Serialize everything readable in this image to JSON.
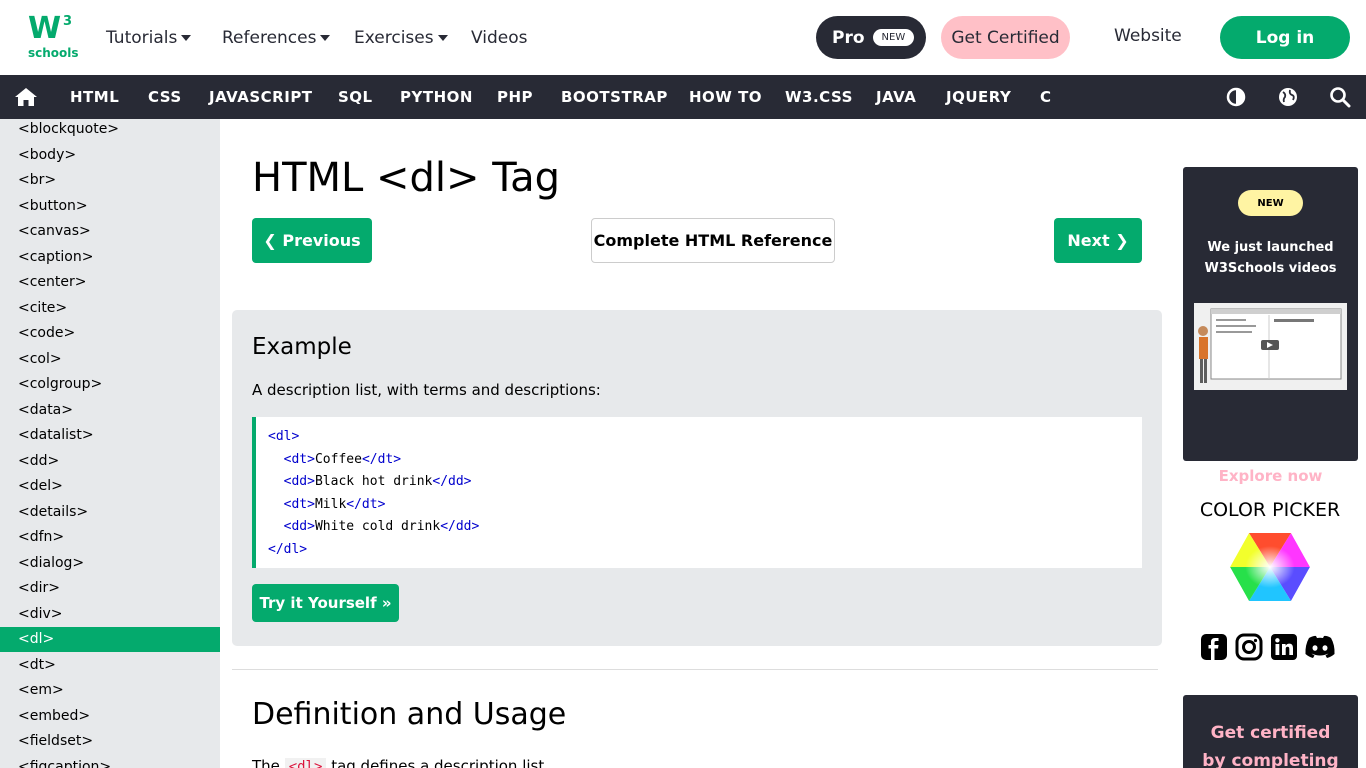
{
  "header": {
    "logo": {
      "main": "W",
      "sup": "3",
      "sub": "schools"
    },
    "menus": [
      {
        "label": "Tutorials"
      },
      {
        "label": "References"
      },
      {
        "label": "Exercises"
      }
    ],
    "videos": "Videos",
    "pro": {
      "label": "Pro",
      "badge": "NEW"
    },
    "get_certified": "Get Certified",
    "website": "Website",
    "login": "Log in"
  },
  "navbar": {
    "items": [
      "HTML",
      "CSS",
      "JAVASCRIPT",
      "SQL",
      "PYTHON",
      "PHP",
      "BOOTSTRAP",
      "HOW TO",
      "W3.CSS",
      "JAVA",
      "JQUERY",
      "C"
    ],
    "icons": [
      "home-icon",
      "contrast-icon",
      "globe-icon",
      "search-icon"
    ]
  },
  "sidebar": {
    "items": [
      "<blockquote>",
      "<body>",
      "<br>",
      "<button>",
      "<canvas>",
      "<caption>",
      "<center>",
      "<cite>",
      "<code>",
      "<col>",
      "<colgroup>",
      "<data>",
      "<datalist>",
      "<dd>",
      "<del>",
      "<details>",
      "<dfn>",
      "<dialog>",
      "<dir>",
      "<div>",
      "<dl>",
      "<dt>",
      "<em>",
      "<embed>",
      "<fieldset>",
      "<figcaption>"
    ],
    "active_index": 20
  },
  "main": {
    "title": "HTML <dl> Tag",
    "prev": "❮ Previous",
    "reference": "Complete HTML Reference",
    "next": "Next ❯",
    "example": {
      "heading": "Example",
      "description": "A description list, with terms and descriptions:",
      "code": [
        {
          "indent": "",
          "open": "<dl>",
          "text": "",
          "close": ""
        },
        {
          "indent": "  ",
          "open": "<dt>",
          "text": "Coffee",
          "close": "</dt>"
        },
        {
          "indent": "  ",
          "open": "<dd>",
          "text": "Black hot drink",
          "close": "</dd>"
        },
        {
          "indent": "  ",
          "open": "<dt>",
          "text": "Milk",
          "close": "</dt>"
        },
        {
          "indent": "  ",
          "open": "<dd>",
          "text": "White cold drink",
          "close": "</dd>"
        },
        {
          "indent": "",
          "open": "</dl>",
          "text": "",
          "close": ""
        }
      ],
      "try_button": "Try it Yourself »"
    },
    "definition": {
      "heading": "Definition and Usage",
      "line_prefix": "The",
      "line_code": "<dl>",
      "line_suffix": "tag defines a description list."
    }
  },
  "right": {
    "promo": {
      "badge": "NEW",
      "line1": "We just launched",
      "line2": "W3Schools videos",
      "cta": "Explore now"
    },
    "color_picker": "COLOR PICKER",
    "social": [
      "facebook-icon",
      "instagram-icon",
      "linkedin-icon",
      "discord-icon"
    ],
    "promo2": {
      "line1": "Get certified",
      "line2": "by completing"
    }
  },
  "colors": {
    "brand_green": "#04AA6D",
    "dark_nav": "#282A35",
    "sidebar_bg": "#E7E9EB",
    "pink": "#FFC0C7"
  }
}
